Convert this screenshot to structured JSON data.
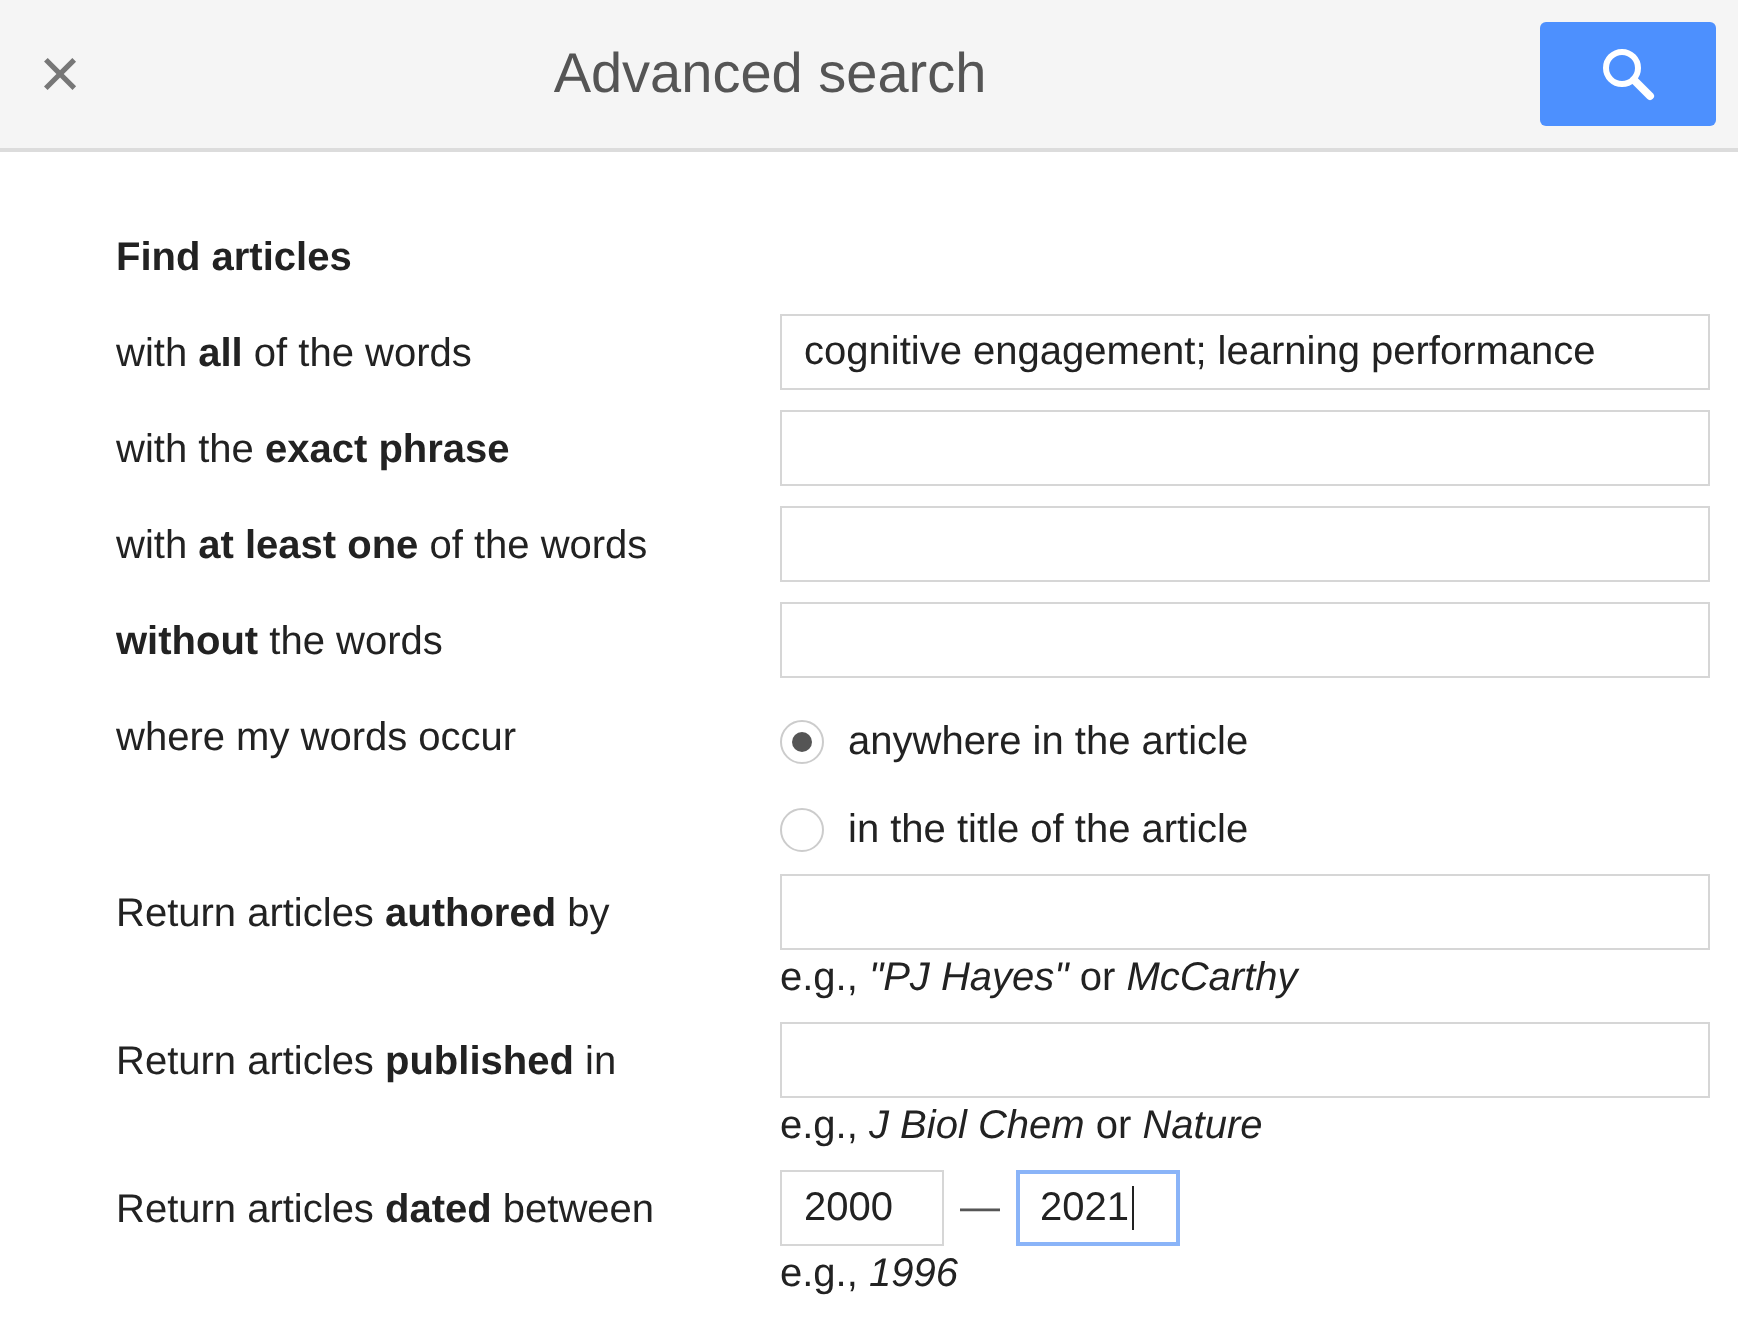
{
  "header": {
    "close": "×",
    "title": "Advanced search"
  },
  "section_title": "Find articles",
  "rows": [
    {
      "kind": "text",
      "label": "with **all** of the words",
      "value": "cognitive engagement; learning performance"
    },
    {
      "kind": "text",
      "label": "with the **exact phrase**"
    },
    {
      "kind": "text",
      "label": "with **at least one** of the words"
    },
    {
      "kind": "text",
      "label": "**without** the words"
    },
    {
      "kind": "radio",
      "label": "where my words occur",
      "options": [
        {
          "label": "anywhere in the article",
          "selected": true
        },
        {
          "label": "in the title of the article",
          "selected": false
        }
      ]
    },
    {
      "kind": "text",
      "label": "Return articles **authored** by",
      "hint": "e.g., *\"PJ Hayes\"* or *McCarthy*"
    },
    {
      "kind": "text",
      "label": "Return articles **published** in",
      "hint": "e.g., *J Biol Chem* or *Nature*"
    },
    {
      "kind": "dates",
      "label": "Return articles **dated** between",
      "separator": "—",
      "fields": [
        {
          "value": "2000",
          "focused": false
        },
        {
          "value": "2021",
          "focused": true
        }
      ],
      "hint": "e.g., *1996*"
    }
  ]
}
